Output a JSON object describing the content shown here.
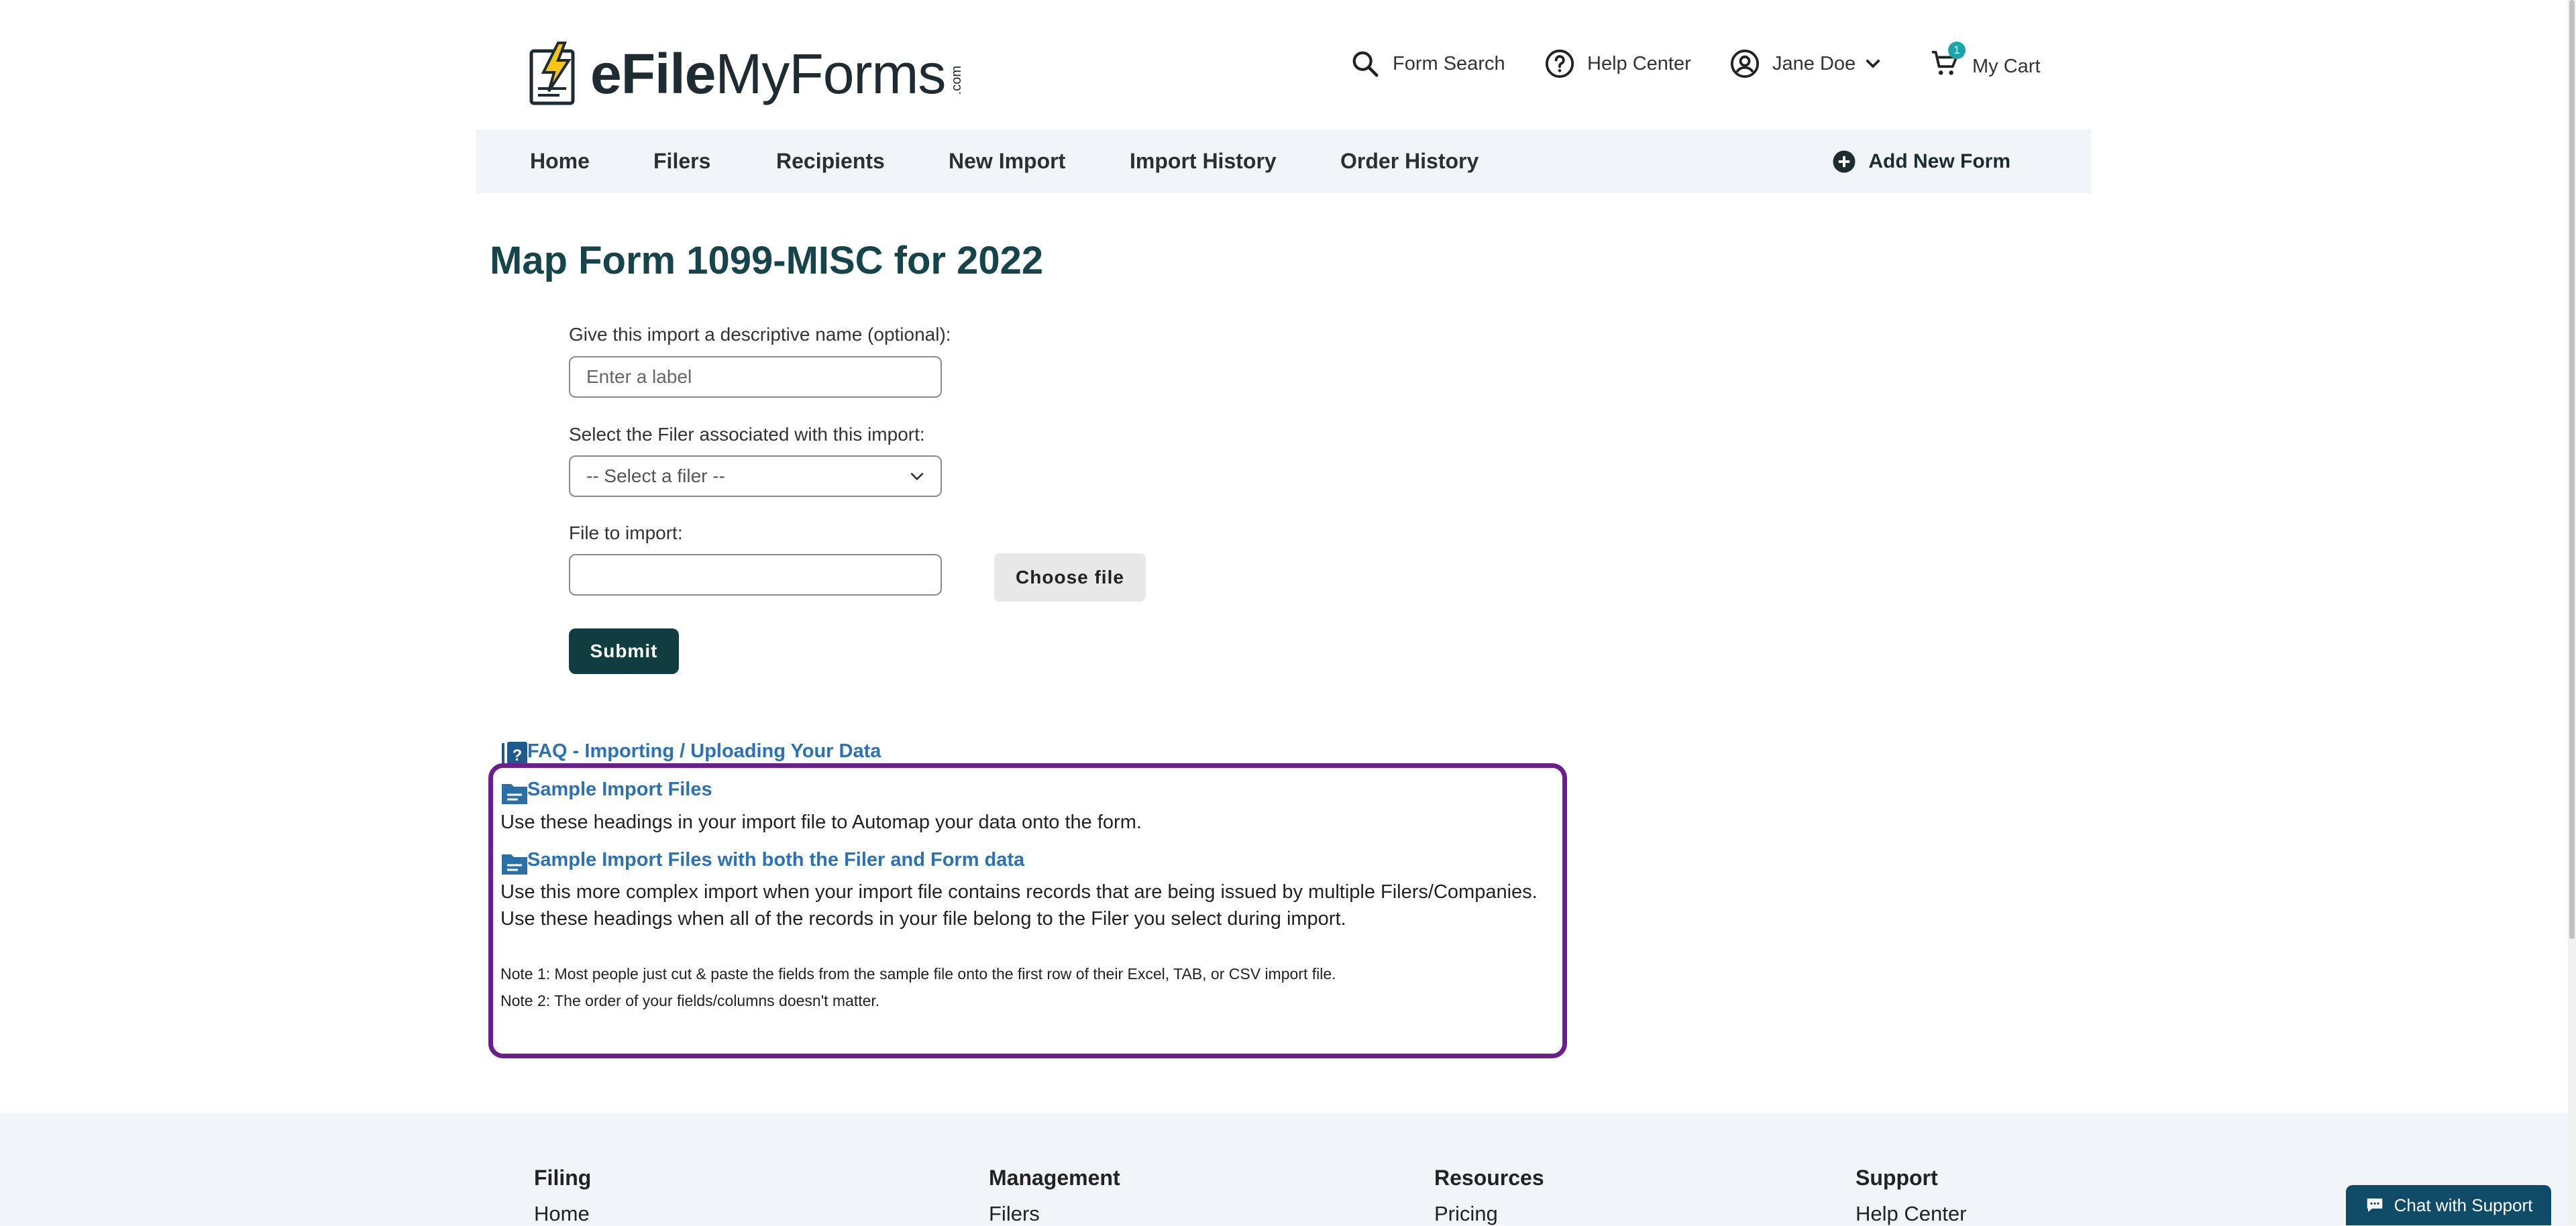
{
  "brand": {
    "logo_bold": "eFile",
    "logo_regular": "MyForms",
    "logo_com": ".com"
  },
  "header": {
    "form_search": "Form Search",
    "help_center": "Help Center",
    "user_name": "Jane Doe",
    "cart_label": "My Cart",
    "cart_count": "1"
  },
  "nav": {
    "items": [
      "Home",
      "Filers",
      "Recipients",
      "New Import",
      "Import History",
      "Order History"
    ],
    "add_new_form": "Add New Form"
  },
  "page": {
    "title": "Map Form 1099-MISC for 2022"
  },
  "form": {
    "name_label": "Give this import a descriptive name (optional):",
    "name_placeholder": "Enter a label",
    "filer_label": "Select the Filer associated with this import:",
    "filer_value": "-- Select a filer --",
    "file_label": "File to import:",
    "choose_file": "Choose file",
    "submit": "Submit"
  },
  "help": {
    "faq_link": "FAQ - Importing / Uploading Your Data",
    "sample_link": "Sample Import Files",
    "sample_desc": "Use these headings in your import file to Automap your data onto the form.",
    "complex_link": "Sample Import Files with both the Filer and Form data",
    "complex_desc": "Use this more complex import when your import file contains records that are being issued by multiple Filers/Companies. Use these headings when all of the records in your file belong to the Filer you select during import.",
    "note1": "Note 1: Most people just cut & paste the fields from the sample file onto the first row of their Excel, TAB, or CSV import file.",
    "note2": "Note 2: The order of your fields/columns doesn't matter."
  },
  "footer": {
    "columns": [
      {
        "heading": "Filing",
        "first_link": "Home"
      },
      {
        "heading": "Management",
        "first_link": "Filers"
      },
      {
        "heading": "Resources",
        "first_link": "Pricing"
      },
      {
        "heading": "Support",
        "first_link": "Help Center"
      }
    ]
  },
  "chat": {
    "label": "Chat with Support"
  },
  "colors": {
    "accent": "#15454a",
    "link": "#2a72b5",
    "highlight": "#6a1f8a",
    "button": "#0f3d40"
  }
}
